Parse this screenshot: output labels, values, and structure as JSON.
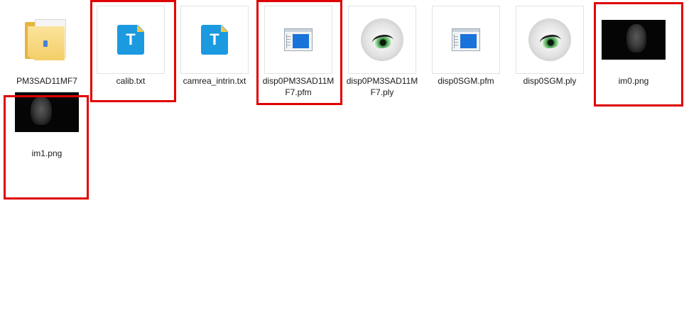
{
  "window": {
    "view": "file-explorer-large-icons"
  },
  "files": [
    {
      "name": "PM3SAD11MF7",
      "icon": "folder-icon",
      "highlighted": false
    },
    {
      "name": "calib.txt",
      "icon": "text-file-icon",
      "highlighted": true
    },
    {
      "name": "camrea_intrin.txt",
      "icon": "text-file-icon",
      "highlighted": false
    },
    {
      "name": "disp0PM3SAD11MF7.pfm",
      "icon": "window-file-icon",
      "highlighted": true
    },
    {
      "name": "disp0PM3SAD11MF7.ply",
      "icon": "eye-viewer-icon",
      "highlighted": false
    },
    {
      "name": "disp0SGM.pfm",
      "icon": "window-file-icon",
      "highlighted": false
    },
    {
      "name": "disp0SGM.ply",
      "icon": "eye-viewer-icon",
      "highlighted": false
    },
    {
      "name": "im0.png",
      "icon": "image-thumbnail",
      "highlighted": true
    },
    {
      "name": "im1.png",
      "icon": "image-thumbnail",
      "highlighted": true
    }
  ],
  "icon_glyphs": {
    "text_file": "T"
  },
  "colors": {
    "highlight_border": "#e00000",
    "folder": "#f4cf68",
    "text_icon": "#1b9ae0",
    "window_pane": "#1a73d9"
  }
}
